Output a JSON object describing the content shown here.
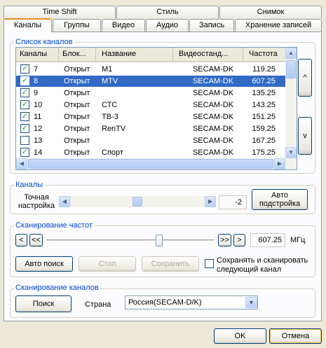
{
  "tabs_row1": [
    "Time Shift",
    "Стиль",
    "Снимок"
  ],
  "tabs_row2": [
    "Каналы",
    "Группы",
    "Видео",
    "Аудио",
    "Запись",
    "Хранение записей"
  ],
  "channel_list": {
    "title": "Список каналов",
    "columns": [
      "Каналы",
      "Блок...",
      "Название",
      "Видеостанд...",
      "Частота"
    ],
    "rows": [
      {
        "checked": true,
        "num": "7",
        "block": "Открыт",
        "name": "M1",
        "std": "SECAM-DK",
        "freq": "119.25",
        "selected": false
      },
      {
        "checked": true,
        "num": "8",
        "block": "Открыт",
        "name": "MTV",
        "std": "SECAM-DK",
        "freq": "607.25",
        "selected": true
      },
      {
        "checked": true,
        "num": "9",
        "block": "Открыт",
        "name": "",
        "std": "SECAM-DK",
        "freq": "135.25",
        "selected": false
      },
      {
        "checked": true,
        "num": "10",
        "block": "Открыт",
        "name": "СТС",
        "std": "SECAM-DK",
        "freq": "143.25",
        "selected": false
      },
      {
        "checked": true,
        "num": "11",
        "block": "Открыт",
        "name": "ТВ-3",
        "std": "SECAM-DK",
        "freq": "151.25",
        "selected": false
      },
      {
        "checked": true,
        "num": "12",
        "block": "Открыт",
        "name": "RenTV",
        "std": "SECAM-DK",
        "freq": "159.25",
        "selected": false
      },
      {
        "checked": false,
        "num": "13",
        "block": "Открыт",
        "name": "",
        "std": "SECAM-DK",
        "freq": "167.25",
        "selected": false
      },
      {
        "checked": true,
        "num": "14",
        "block": "Открыт",
        "name": "Спорт",
        "std": "SECAM-DK",
        "freq": "175.25",
        "selected": false
      }
    ],
    "move_up": "^",
    "move_down": "v"
  },
  "channels": {
    "title": "Каналы",
    "fine_tune_label": "Точная настройка",
    "fine_tune_value": "-2",
    "auto_tune_button": "Авто подстройка",
    "fine_tune_level": 0.5
  },
  "scan_freq": {
    "title": "Сканирование частот",
    "btn_prev": "<",
    "btn_prev_fast": "<<",
    "btn_next_fast": ">>",
    "btn_next": ">",
    "freq_value": "607.25",
    "unit": "МГц",
    "slider_level": 0.68,
    "auto_search": "Авто поиск",
    "stop": "Стоп",
    "save": "Сохранить",
    "save_scan_next": "Сохранять и сканировать следующий канал"
  },
  "scan_channels": {
    "title": "Сканирование каналов",
    "search_button": "Поиск",
    "country_label": "Страна",
    "country_value": "Россия(SECAM-D/K)"
  },
  "dialog": {
    "ok": "OK",
    "cancel": "Отмена"
  },
  "colors": {
    "selection": "#316ac5",
    "group_title": "#0046d5",
    "check": "#21a121"
  }
}
